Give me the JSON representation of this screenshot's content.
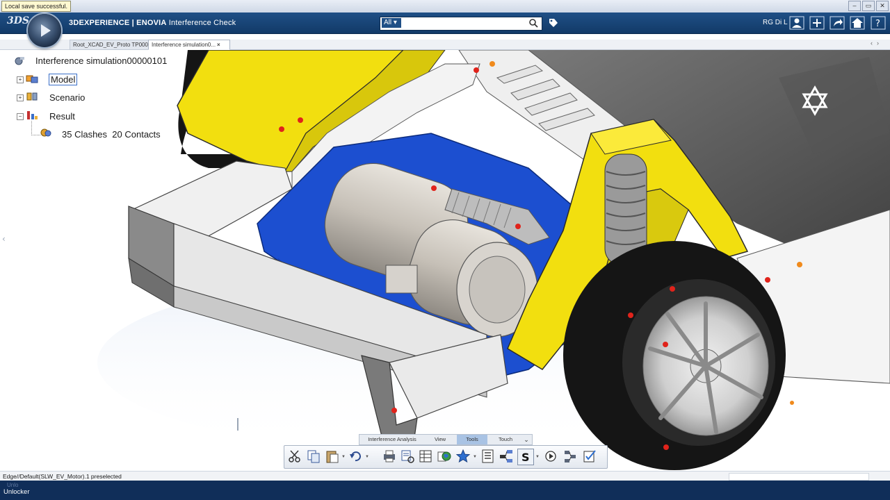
{
  "window": {
    "toast": "Local save successful.",
    "controls": [
      "–",
      "▭",
      "✕"
    ]
  },
  "header": {
    "brand_logo": "3DS",
    "title_brand": "3DEXPERIENCE | ENOVIA",
    "title_app": " Interference Check",
    "search_scope": "All ▾",
    "search_placeholder": "",
    "user": "RG Di L",
    "icons": [
      "user-icon",
      "add-icon",
      "share-icon",
      "home-icon",
      "help-icon"
    ]
  },
  "tabs": [
    {
      "label": "Root_XCAD_EV_Proto TP000..."
    },
    {
      "label": "Interference simulation0..."
    }
  ],
  "tree": {
    "root": "Interference simulation00000101",
    "model": "Model",
    "scenario": "Scenario",
    "result": "Result",
    "clashes": "35 Clashes",
    "contacts": "20 Contacts"
  },
  "action_bar": {
    "tabs": [
      "Interference Analysis",
      "View",
      "Tools",
      "Touch"
    ],
    "active_tab": "Tools",
    "tools": [
      "cut-icon",
      "copy-icon",
      "paste-icon",
      "undo-icon",
      "print-icon",
      "properties-icon",
      "table-icon",
      "globe-icon",
      "favorite-icon",
      "list-icon",
      "tree-icon",
      "s-tool-icon",
      "play-icon",
      "filter-icon",
      "check-icon"
    ]
  },
  "status": {
    "text": "Edge//Default(SLW_EV_Motor).1 preselected"
  },
  "taskbar": {
    "ghost": "Unlo",
    "label": "Unlocker"
  },
  "colors": {
    "header_blue": "#1a4579",
    "part_yellow": "#f2df0f",
    "part_blue": "#1c4fd0",
    "clash_red": "#e0231b",
    "tire_black": "#151515"
  }
}
